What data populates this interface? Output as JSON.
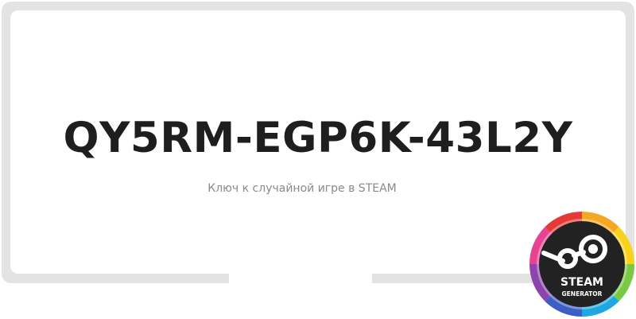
{
  "key": {
    "value": "QY5RM-EGP6K-43L2Y"
  },
  "subtitle": {
    "text": "Ключ к случайной игре в STEAM"
  },
  "badge": {
    "icon": "steam-logo-icon",
    "line1": "STEAM",
    "line2": "GENERATOR"
  },
  "colors": {
    "frame": "#e3e3e3",
    "key_text": "#1e1e1e",
    "subtitle_text": "#8a8a8a",
    "badge_inner": "#222222"
  }
}
